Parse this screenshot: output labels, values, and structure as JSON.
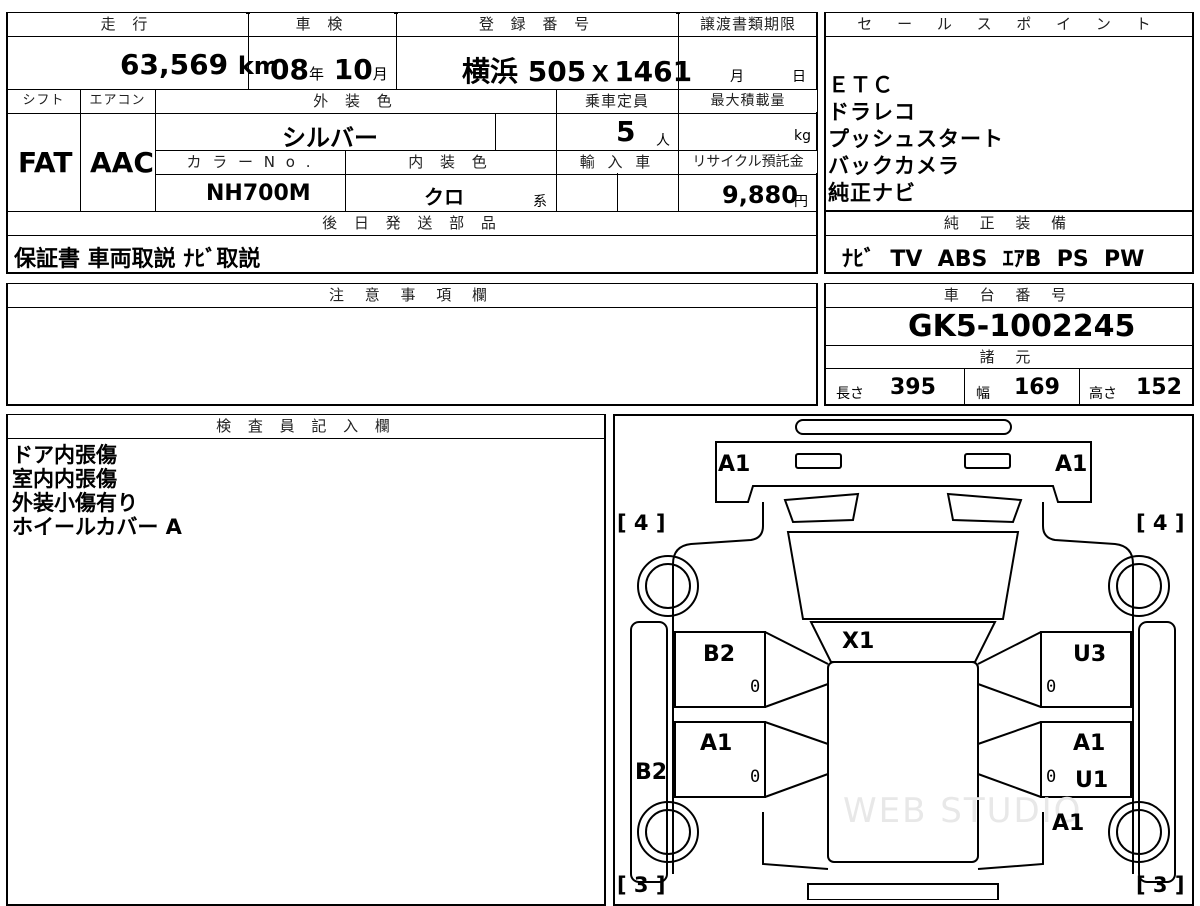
{
  "vehicle": {
    "headers": {
      "mileage": "走 行",
      "inspection": "車 検",
      "registration": "登 録 番 号",
      "transfer_deadline": "譲渡書類期限",
      "shift": "シフト",
      "aircon": "エアコン",
      "exterior_color": "外 装 色",
      "capacity": "乗車定員",
      "max_load": "最大積載量",
      "color_no": "カ ラ ー N o .",
      "interior_color": "内 装 色",
      "import": "輸 入 車",
      "recycle": "リサイクル預託金",
      "later_parts": "後 日 発 送 部 品"
    },
    "mileage_value": "63,569",
    "mileage_unit": "km",
    "inspection_year": "08",
    "inspection_year_unit": "年",
    "inspection_month": "10",
    "inspection_month_unit": "月",
    "registration_value": "横浜 505ｘ1461",
    "transfer_month_unit": "月",
    "transfer_day_unit": "日",
    "shift_value": "FAT",
    "aircon_value": "AAC",
    "exterior_color_value": "シルバー",
    "capacity_value": "5",
    "capacity_unit": "人",
    "max_load_unit": "kg",
    "color_no_value": "NH700M",
    "interior_color_value": "クロ",
    "interior_color_suffix": "系",
    "recycle_value": "9,880",
    "recycle_unit": "円",
    "later_parts_value": "保証書 車両取説 ﾅﾋﾞ取説"
  },
  "sales_points": {
    "header": "セ ー ル ス ポ イ ン ト",
    "items": [
      "ＥＴＣ",
      "ドラレコ",
      "プッシュスタート",
      "バックカメラ",
      "純正ナビ"
    ]
  },
  "equipment": {
    "header": "純 正 装 備",
    "value": "ﾅﾋﾞ  TV  ABS  ｴｱB  PS  PW"
  },
  "notes": {
    "header": "注 意 事 項 欄"
  },
  "chassis": {
    "header": "車 台 番 号",
    "value": "GK5-1002245"
  },
  "specs": {
    "header": "諸 元",
    "length_label": "長さ",
    "length_value": "395",
    "width_label": "幅",
    "width_value": "169",
    "height_label": "高さ",
    "height_value": "152"
  },
  "inspector": {
    "header": "検 査 員 記 入 欄",
    "lines": [
      "ドア内張傷",
      "室内内張傷",
      "外装小傷有り",
      "ホイールカバー A"
    ]
  },
  "diagram": {
    "labels": {
      "front_left": "A1",
      "front_right": "A1",
      "tire_fl": "[ 4 ]",
      "tire_fr": "[ 4 ]",
      "tire_rl": "[ 3 ]",
      "tire_rr": "[ 3 ]",
      "windshield": "X1",
      "left_front_door": "B2",
      "left_rear_door": "A1",
      "left_side": "B2",
      "right_front_door": "U3",
      "right_rear_door": "A1",
      "right_rear_door_2": "U1",
      "right_rear_quarter": "A1",
      "zero": "0"
    },
    "watermark": "WEB STUDIO"
  }
}
